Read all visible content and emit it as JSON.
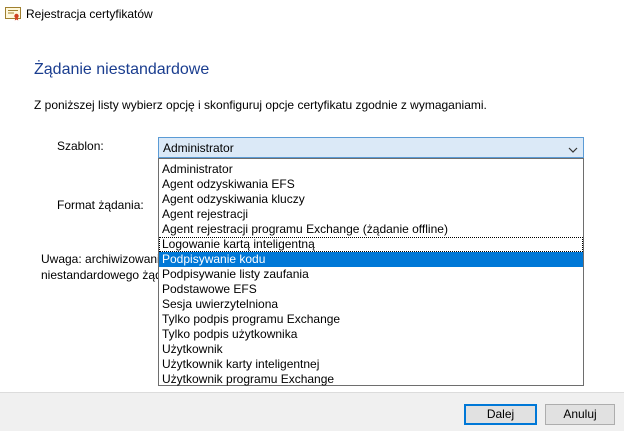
{
  "window": {
    "title": "Rejestracja certyfikatów"
  },
  "page": {
    "heading": "Żądanie niestandardowe",
    "intro": "Z poniższej listy wybierz opcję i skonfiguruj opcje certyfikatu zgodnie z wymaganiami.",
    "template_label": "Szablon:",
    "format_label": "Format żądania:",
    "note_line1": "Uwaga: archiwizowani",
    "note_line2": "niestandardowego żąd"
  },
  "template_select": {
    "value": "Administrator",
    "options": [
      "Administrator",
      "Agent odzyskiwania EFS",
      "Agent odzyskiwania kluczy",
      "Agent rejestracji",
      "Agent rejestracji programu Exchange (żądanie offline)",
      "Logowanie kartą inteligentną",
      "Podpisywanie kodu",
      "Podpisywanie listy zaufania",
      "Podstawowe EFS",
      "Sesja uwierzytelniona",
      "Tylko podpis programu Exchange",
      "Tylko podpis użytkownika",
      "Użytkownik",
      "Użytkownik karty inteligentnej",
      "Użytkownik programu Exchange"
    ],
    "highlighted_option": "Podpisywanie kodu"
  },
  "footer": {
    "next_label": "Dalej",
    "cancel_label": "Anuluj"
  },
  "colors": {
    "heading": "#1a3d8f",
    "highlight": "#0078d7",
    "select_bg": "#dbe9f7"
  },
  "icons": {
    "window": "certificate-icon",
    "dropdown": "chevron-down-icon"
  }
}
